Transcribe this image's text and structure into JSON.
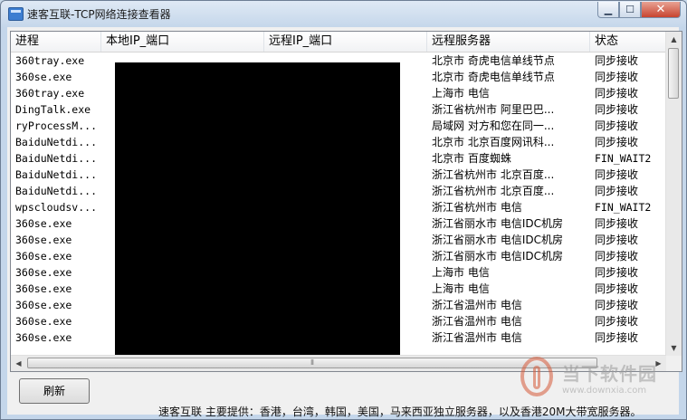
{
  "window": {
    "title": "速客互联-TCP网络连接查看器"
  },
  "columns": [
    "进程",
    "本地IP_端口",
    "远程IP_端口",
    "远程服务器",
    "状态"
  ],
  "rows": [
    {
      "process": "360tray.exe",
      "server": "北京市 奇虎电信单线节点",
      "status": "同步接收"
    },
    {
      "process": "360se.exe",
      "server": "北京市 奇虎电信单线节点",
      "status": "同步接收"
    },
    {
      "process": "360tray.exe",
      "server": "上海市 电信",
      "status": "同步接收"
    },
    {
      "process": "DingTalk.exe",
      "server": "浙江省杭州市 阿里巴巴...",
      "status": "同步接收"
    },
    {
      "process": "ryProcessM...",
      "server": "局域网 对方和您在同一...",
      "status": "同步接收"
    },
    {
      "process": "BaiduNetdi...",
      "server": "北京市 北京百度网讯科...",
      "status": "同步接收"
    },
    {
      "process": "BaiduNetdi...",
      "server": "北京市 百度蜘蛛",
      "status": "FIN_WAIT2"
    },
    {
      "process": "BaiduNetdi...",
      "server": "浙江省杭州市 北京百度...",
      "status": "同步接收"
    },
    {
      "process": "BaiduNetdi...",
      "server": "浙江省杭州市 北京百度...",
      "status": "同步接收"
    },
    {
      "process": "wpscloudsv...",
      "server": "浙江省杭州市 电信",
      "status": "FIN_WAIT2"
    },
    {
      "process": "360se.exe",
      "server": "浙江省丽水市 电信IDC机房",
      "status": "同步接收"
    },
    {
      "process": "360se.exe",
      "server": "浙江省丽水市 电信IDC机房",
      "status": "同步接收"
    },
    {
      "process": "360se.exe",
      "server": "浙江省丽水市 电信IDC机房",
      "status": "同步接收"
    },
    {
      "process": "360se.exe",
      "server": "上海市 电信",
      "status": "同步接收"
    },
    {
      "process": "360se.exe",
      "server": "上海市 电信",
      "status": "同步接收"
    },
    {
      "process": "360se.exe",
      "server": "浙江省温州市 电信",
      "status": "同步接收"
    },
    {
      "process": "360se.exe",
      "server": "浙江省温州市 电信",
      "status": "同步接收"
    },
    {
      "process": "360se.exe",
      "server": "浙江省温州市 电信",
      "status": "同步接收"
    }
  ],
  "buttons": {
    "refresh": "刷新"
  },
  "footer": "速客互联 主要提供：香港，台湾，韩国，美国，马来西亚独立服务器，以及香港20M大带宽服务器。",
  "watermark": {
    "name": "当下软件园",
    "url": "www.downxia.com"
  }
}
